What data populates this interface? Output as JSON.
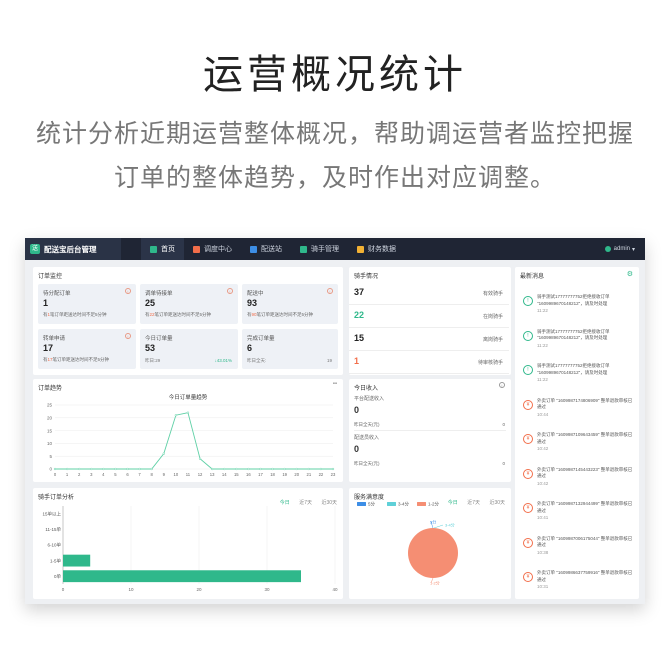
{
  "hero": {
    "title": "运营概况统计",
    "desc_line1": "统计分析近期运营整体概况，帮助调运营者监控把握",
    "desc_line2": "订单的整体趋势，及时作出对应调整。"
  },
  "topbar": {
    "brand": "配送宝后台管理",
    "brand_logo": "送",
    "nav": [
      {
        "label": "首页",
        "color": "#2fb88b"
      },
      {
        "label": "调度中心",
        "color": "#f26e4a"
      },
      {
        "label": "配送站",
        "color": "#3d8ee6"
      },
      {
        "label": "骑手管理",
        "color": "#2fb88b"
      },
      {
        "label": "财务数据",
        "color": "#f2b134"
      }
    ],
    "user": "admin"
  },
  "order_monitor": {
    "title": "订单监控",
    "cards": [
      {
        "title": "待分配订单",
        "value": "1",
        "note_pre": "有",
        "note_num": "1",
        "note_post": "笔订单距送达时间不足5分钟"
      },
      {
        "title": "调单待接单",
        "value": "25",
        "note_pre": "有",
        "note_num": "22",
        "note_post": "笔订单距送达时间不足5分钟"
      },
      {
        "title": "配送中",
        "value": "93",
        "note_pre": "有",
        "note_num": "90",
        "note_post": "笔订单距送达时间不足5分钟"
      },
      {
        "title": "转单申请",
        "value": "17",
        "note_pre": "有",
        "note_num": "17",
        "note_post": "笔订单距送达时间不足5分钟"
      },
      {
        "title": "今日订单量",
        "value": "53",
        "sub": "昨日:29",
        "rate": "↓43.01%"
      },
      {
        "title": "完成订单量",
        "value": "6",
        "sub": "昨日全天:",
        "rate": "19"
      }
    ]
  },
  "rider_status": {
    "title": "骑手情况",
    "rows": [
      {
        "value": "37",
        "label": "有效骑手",
        "color": "#222"
      },
      {
        "value": "22",
        "label": "在岗骑手",
        "color": "#2fb88b"
      },
      {
        "value": "15",
        "label": "离岗骑手",
        "color": "#222"
      },
      {
        "value": "1",
        "label": "待审核骑手",
        "color": "#f26e4a"
      }
    ]
  },
  "latest_messages": {
    "title": "最新消息",
    "items": [
      {
        "text": "骑手测试17777777752拒绝接收订单 \"1609989670148212\"，请及时处理",
        "time": "11:22",
        "type": "green"
      },
      {
        "text": "骑手测试17777777752拒绝接收订单 \"1609989670148212\"，请及时处理",
        "time": "11:22",
        "type": "green"
      },
      {
        "text": "骑手测试17777777752拒绝接收订单 \"1609989670148212\"，请及时处理",
        "time": "11:22",
        "type": "green"
      },
      {
        "text": "外卖订单 \"1609987174806909\" 整单退款审核已通过",
        "time": "10:44",
        "type": "orange"
      },
      {
        "text": "外卖订单 \"1609987109643459\" 整单退款审核已通过",
        "time": "10:42",
        "type": "orange"
      },
      {
        "text": "外卖订单 \"1609987145443223\" 整单退款审核已通过",
        "time": "10:42",
        "type": "orange"
      },
      {
        "text": "外卖订单 \"1609987132944499\" 整单退款审核已通过",
        "time": "10:41",
        "type": "orange"
      },
      {
        "text": "外卖订单 \"1609987006175044\" 整单退款审核已通过",
        "time": "10:38",
        "type": "orange"
      },
      {
        "text": "外卖订单 \"1609986637759916\" 整单退款审核已通过",
        "time": "10:31",
        "type": "orange"
      }
    ]
  },
  "order_trend": {
    "title": "订单趋势",
    "chart_title": "今日订单量趋势"
  },
  "today_income": {
    "title": "今日收入",
    "platform_label": "平台配送收入",
    "platform_value": "0",
    "platform_yesterday": "昨日全天(元)",
    "platform_yesterday_value": "0",
    "rider_label": "配送员收入",
    "rider_value": "0",
    "rider_yesterday": "昨日全天(元)",
    "rider_yesterday_value": "0"
  },
  "rider_orders": {
    "title": "骑手订单分析",
    "tabs": [
      "今日",
      "近7天",
      "近30天"
    ]
  },
  "satisfaction": {
    "title": "服务满意度",
    "tabs": [
      "今日",
      "近7天",
      "近30天"
    ]
  },
  "chart_data": [
    {
      "type": "line",
      "title": "今日订单量趋势",
      "x": [
        0,
        1,
        2,
        3,
        4,
        5,
        6,
        7,
        8,
        9,
        10,
        11,
        12,
        13,
        14,
        15,
        16,
        17,
        18,
        19,
        20,
        21,
        22,
        23
      ],
      "values": [
        0,
        0,
        0,
        0,
        0,
        0,
        0,
        0,
        0,
        6,
        21,
        22,
        4,
        0,
        0,
        0,
        0,
        0,
        0,
        0,
        0,
        0,
        0,
        0
      ],
      "ylim": [
        0,
        25
      ],
      "yticks": [
        0,
        5,
        10,
        15,
        20,
        25
      ],
      "color": "#5fd0a6"
    },
    {
      "type": "bar",
      "orientation": "horizontal",
      "categories": [
        "0单",
        "1-5单",
        "6-10单",
        "11-15单",
        "15单以上"
      ],
      "values": [
        35,
        4,
        0,
        0,
        0
      ],
      "xlim": [
        0,
        40
      ],
      "xticks": [
        0,
        10,
        20,
        30,
        40
      ],
      "color": "#2fb88b"
    },
    {
      "type": "pie",
      "legend": [
        {
          "label": "5分",
          "color": "#3d8ee6"
        },
        {
          "label": "3-4分",
          "color": "#5fd0d8"
        },
        {
          "label": "1-2分",
          "color": "#f58e73"
        }
      ],
      "slices": [
        {
          "label": "5分",
          "value": 0
        },
        {
          "label": "3-4分",
          "value": 0
        },
        {
          "label": "1-2分",
          "value": 100
        }
      ],
      "color": "#f58e73"
    }
  ]
}
